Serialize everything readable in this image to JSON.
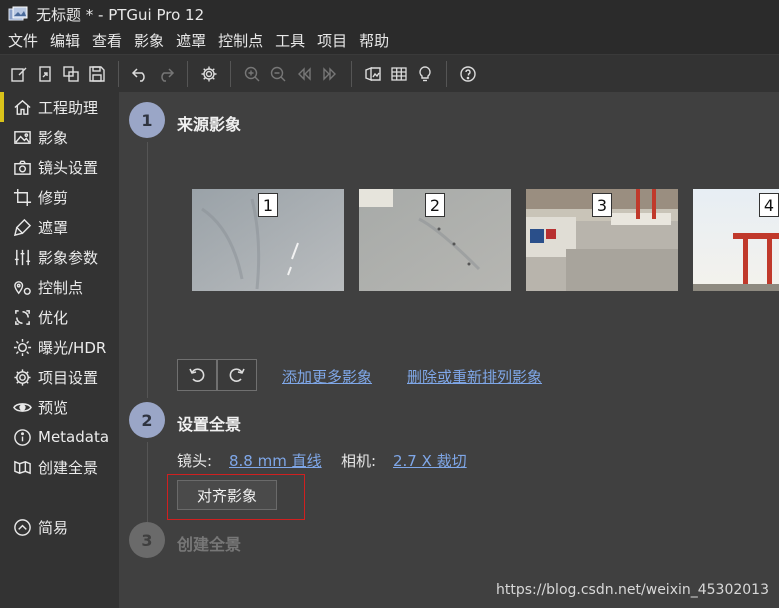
{
  "window": {
    "title": "无标题 * - PTGui Pro 12"
  },
  "menu": [
    "文件",
    "编辑",
    "查看",
    "影象",
    "遮罩",
    "控制点",
    "工具",
    "项目",
    "帮助"
  ],
  "toolbar": {
    "groups": [
      [
        "new-project-icon",
        "open-project-icon",
        "save-as-icon",
        "save-icon"
      ],
      [
        "undo-icon",
        "redo-icon"
      ],
      [
        "settings-gear-icon"
      ],
      [
        "zoom-in-icon",
        "zoom-out-icon",
        "previous-icon",
        "next-icon"
      ],
      [
        "panorama-editor-icon",
        "table-icon",
        "lightbulb-icon"
      ],
      [
        "help-icon"
      ]
    ]
  },
  "sidebar": {
    "items": [
      {
        "label": "工程助理",
        "icon": "home-icon",
        "active": true
      },
      {
        "label": "影象",
        "icon": "image-icon",
        "active": false
      },
      {
        "label": "镜头设置",
        "icon": "camera-icon",
        "active": false
      },
      {
        "label": "修剪",
        "icon": "crop-icon",
        "active": false
      },
      {
        "label": "遮罩",
        "icon": "mask-brush-icon",
        "active": false
      },
      {
        "label": "影象参数",
        "icon": "sliders-icon",
        "active": false
      },
      {
        "label": "控制点",
        "icon": "control-points-icon",
        "active": false
      },
      {
        "label": "优化",
        "icon": "optimize-icon",
        "active": false
      },
      {
        "label": "曝光/HDR",
        "icon": "sun-icon",
        "active": false
      },
      {
        "label": "项目设置",
        "icon": "gear-icon",
        "active": false
      },
      {
        "label": "预览",
        "icon": "eye-icon",
        "active": false
      },
      {
        "label": "Metadata",
        "icon": "info-icon",
        "active": false
      },
      {
        "label": "创建全景",
        "icon": "panorama-icon",
        "active": false
      }
    ],
    "simple_mode": {
      "label": "简易",
      "icon": "chevron-up-circle-icon"
    }
  },
  "steps": {
    "step1": {
      "number": "1",
      "title": "来源影象"
    },
    "step2": {
      "number": "2",
      "title": "设置全景"
    },
    "step3": {
      "number": "3",
      "title": "创建全景"
    }
  },
  "images": [
    {
      "number": "1"
    },
    {
      "number": "2"
    },
    {
      "number": "3"
    },
    {
      "number": "4"
    }
  ],
  "source_actions": {
    "add_more": "添加更多影象",
    "delete_reorder": "删除或重新排列影象"
  },
  "setup": {
    "lens_label": "镜头:",
    "lens_value": "8.8 mm 直线",
    "camera_label": "相机:",
    "camera_value": "2.7 X 裁切",
    "align_button": "对齐影象"
  },
  "watermark": "https://blog.csdn.net/weixin_45302013",
  "colors": {
    "accent_active": "#d9c21a",
    "step_circle": "#9aa6c7",
    "link": "#7fa7e8",
    "highlight": "#d02020"
  }
}
